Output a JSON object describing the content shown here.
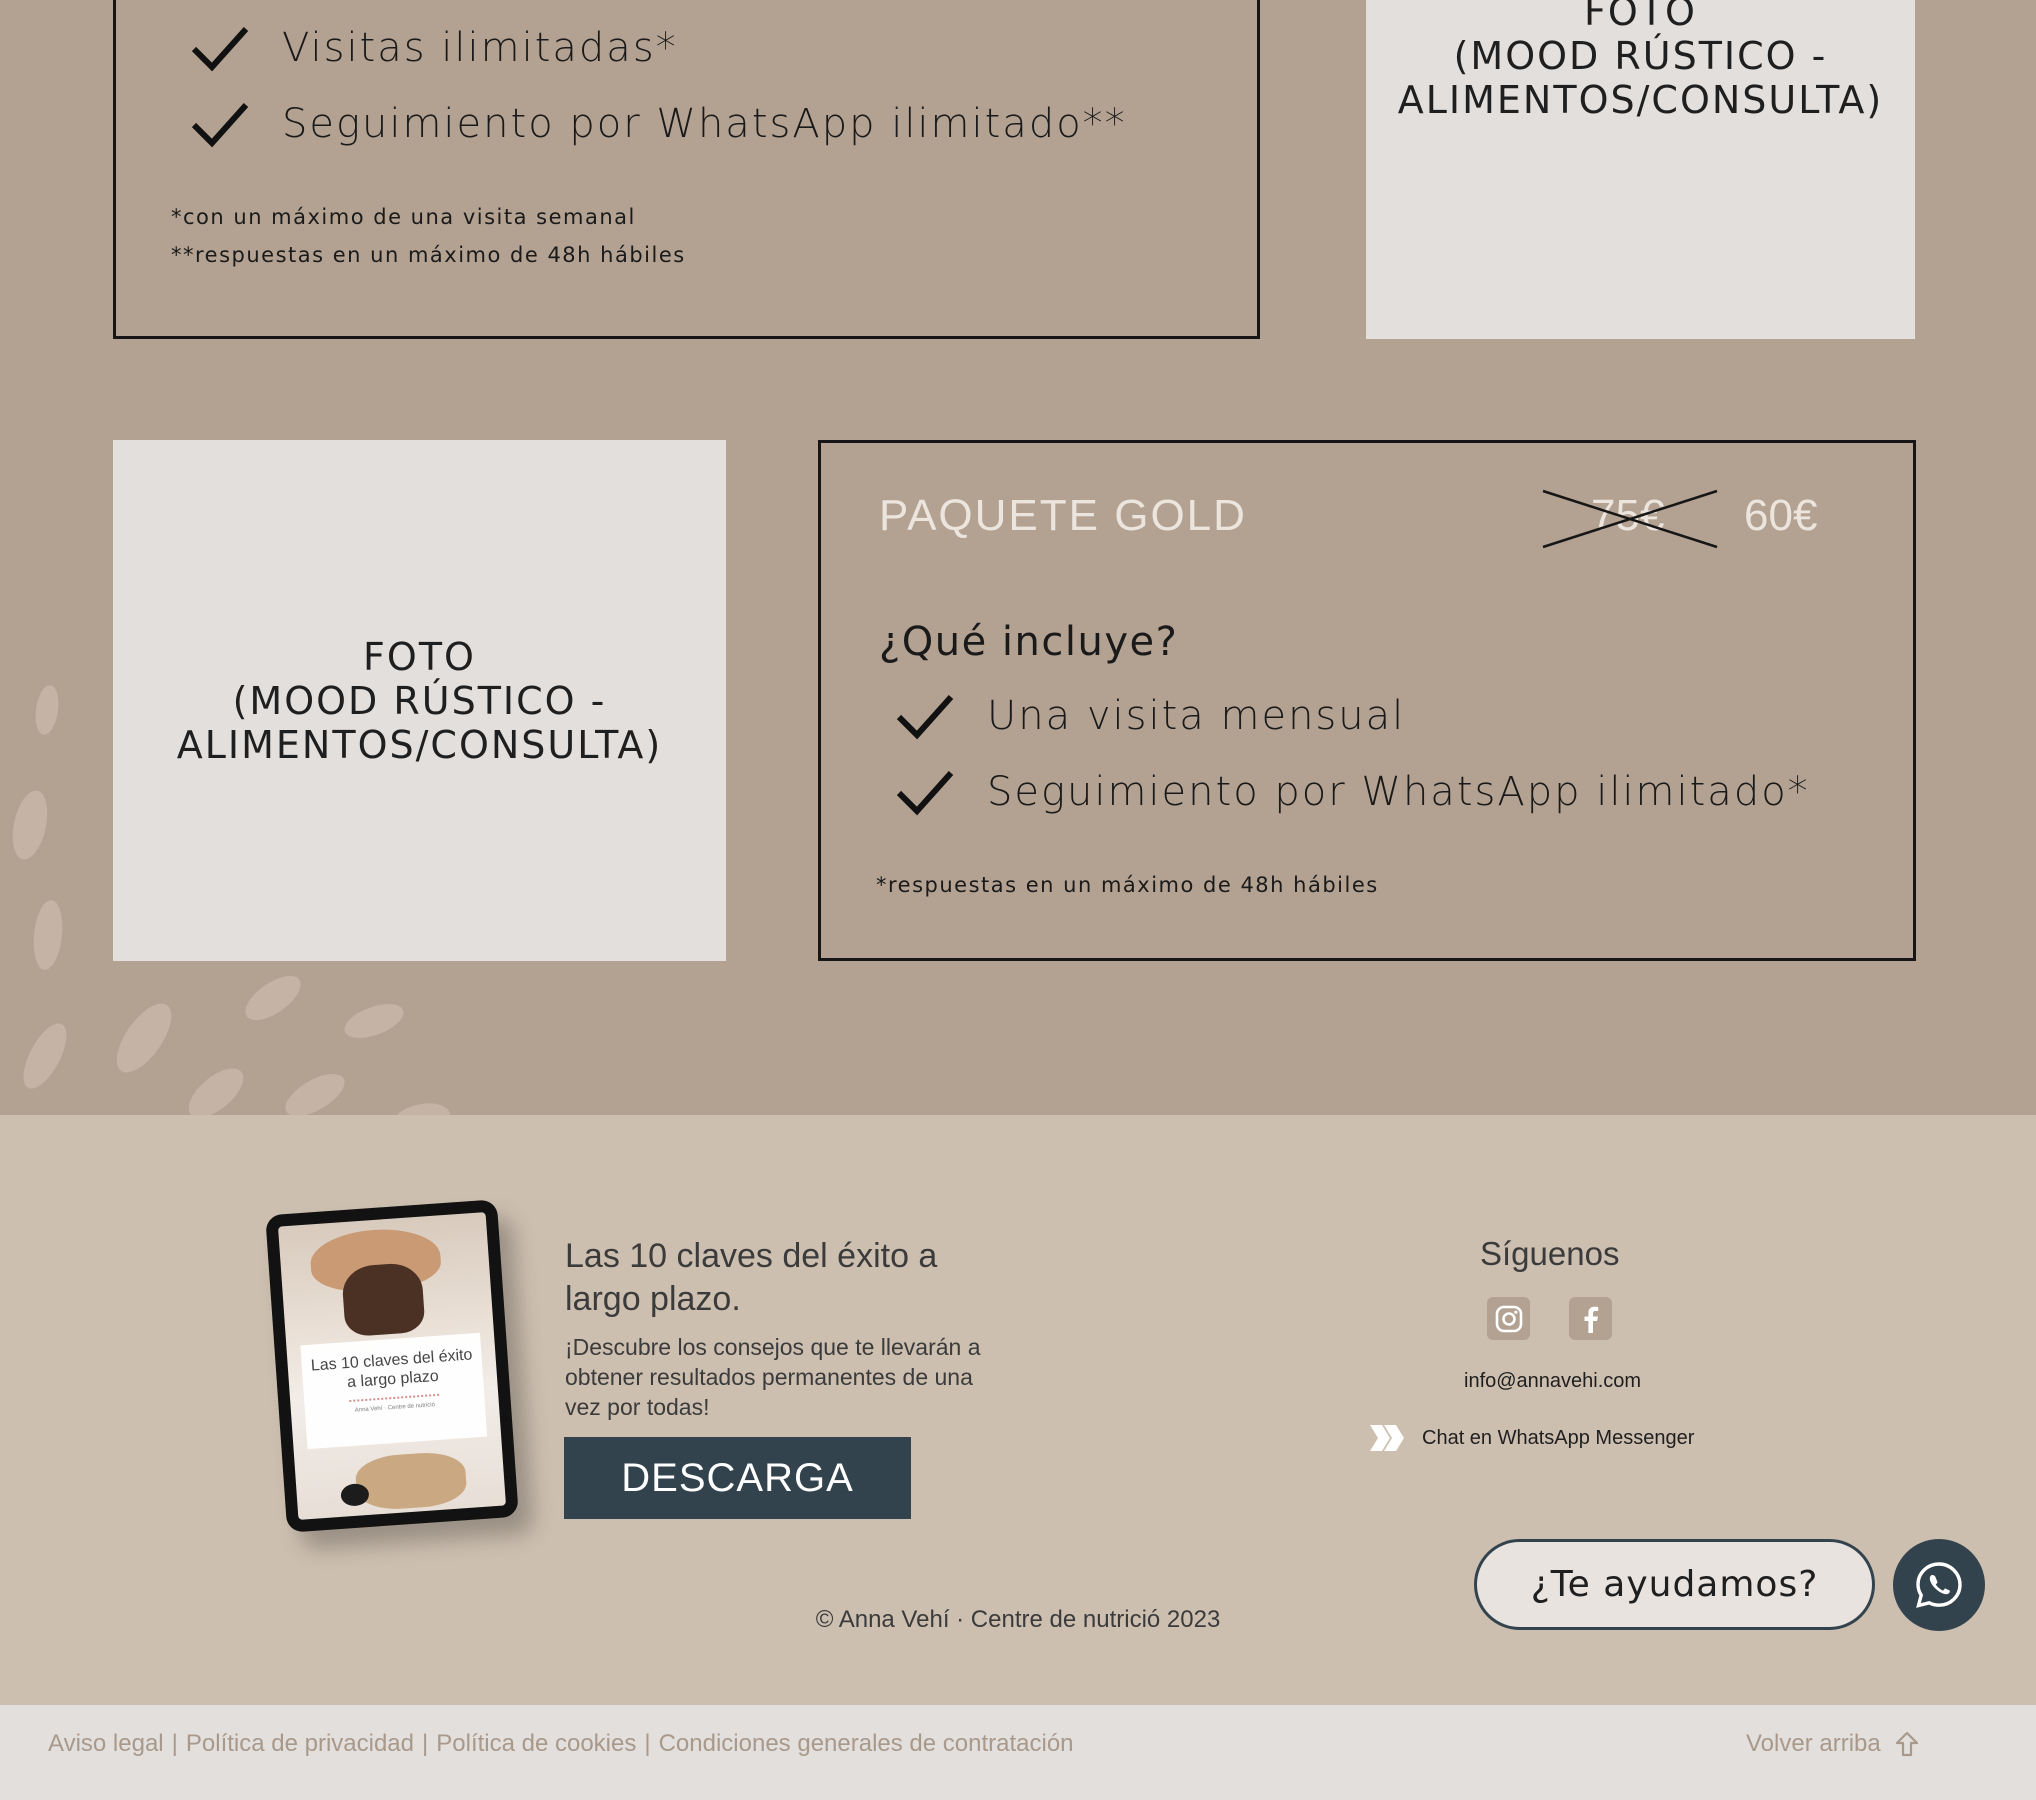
{
  "pricing": {
    "card1": {
      "items": [
        "Visitas ilimitadas*",
        "Seguimiento por WhatsApp ilimitado**"
      ],
      "footnotes": [
        "*con un máximo de una visita semanal",
        "**respuestas en un máximo de 48h hábiles"
      ]
    },
    "photo_top": "FOTO\n(MOOD RÚSTICO -\nALIMENTOS/CONSULTA)",
    "photo_bottom": "FOTO\n(MOOD RÚSTICO -\nALIMENTOS/CONSULTA)",
    "gold": {
      "name": "PAQUETE GOLD",
      "old_price": "75€",
      "new_price": "60€",
      "includes_label": "¿Qué incluye?",
      "items": [
        "Una visita mensual",
        "Seguimiento por WhatsApp ilimitado*"
      ],
      "footnote": "*respuestas en un máximo de 48h hábiles"
    }
  },
  "footer": {
    "ebook": {
      "cover_title": "Las 10 claves del éxito a largo plazo",
      "cover_subtitle": "Anna Vehí · Centre de nutrició",
      "title": "Las 10 claves del éxito a largo plazo.",
      "text": "¡Descubre los consejos que te llevarán a obtener resultados permanentes de una vez por todas!",
      "button": "DESCARGA"
    },
    "follow": {
      "title": "Síguenos",
      "icons": [
        "instagram-icon",
        "facebook-icon"
      ],
      "email": "info@annavehi.com",
      "whatsapp": "Chat en WhatsApp Messenger"
    },
    "help_button": "¿Te ayudamos?",
    "copyright": "© Anna Vehí · Centre de nutrició 2023"
  },
  "bottom_bar": {
    "links": [
      "Aviso legal",
      "Política de privacidad",
      "Política de cookies",
      "Condiciones generales de contratación"
    ],
    "separator": "|",
    "back_to_top": "Volver arriba"
  },
  "colors": {
    "section_bg": "#b3a292",
    "footer_bg": "#cdbfb0",
    "bottom_bar_bg": "#e3dfdc",
    "accent_dark": "#33434d",
    "photo_placeholder": "#e3dfdc"
  }
}
